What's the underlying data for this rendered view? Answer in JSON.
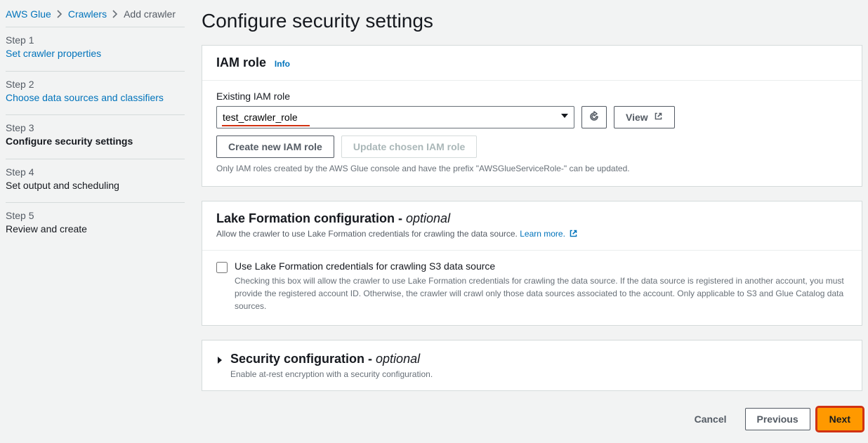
{
  "breadcrumb": {
    "items": [
      "AWS Glue",
      "Crawlers"
    ],
    "current": "Add crawler"
  },
  "steps": [
    {
      "label": "Step 1",
      "title": "Set crawler properties",
      "state": "link"
    },
    {
      "label": "Step 2",
      "title": "Choose data sources and classifiers",
      "state": "link"
    },
    {
      "label": "Step 3",
      "title": "Configure security settings",
      "state": "current"
    },
    {
      "label": "Step 4",
      "title": "Set output and scheduling",
      "state": "disabled"
    },
    {
      "label": "Step 5",
      "title": "Review and create",
      "state": "disabled"
    }
  ],
  "page_title": "Configure security settings",
  "iam_panel": {
    "title": "IAM role",
    "info": "Info",
    "field_label": "Existing IAM role",
    "selected_role": "test_crawler_role",
    "refresh_aria": "Refresh",
    "view_btn": "View",
    "create_btn": "Create new IAM role",
    "update_btn": "Update chosen IAM role",
    "helper": "Only IAM roles created by the AWS Glue console and have the prefix \"AWSGlueServiceRole-\" can be updated."
  },
  "lake_panel": {
    "title": "Lake Formation configuration - ",
    "optional": "optional",
    "desc": "Allow the crawler to use Lake Formation credentials for crawling the data source. ",
    "learn_more": "Learn more.",
    "checkbox_label": "Use Lake Formation credentials for crawling S3 data source",
    "checkbox_desc": "Checking this box will allow the crawler to use Lake Formation credentials for crawling the data source. If the data source is registered in another account, you must provide the registered account ID. Otherwise, the crawler will crawl only those data sources associated to the account. Only applicable to S3 and Glue Catalog data sources."
  },
  "security_panel": {
    "title": "Security configuration - ",
    "optional": "optional",
    "desc": "Enable at-rest encryption with a security configuration."
  },
  "footer": {
    "cancel": "Cancel",
    "previous": "Previous",
    "next": "Next"
  }
}
